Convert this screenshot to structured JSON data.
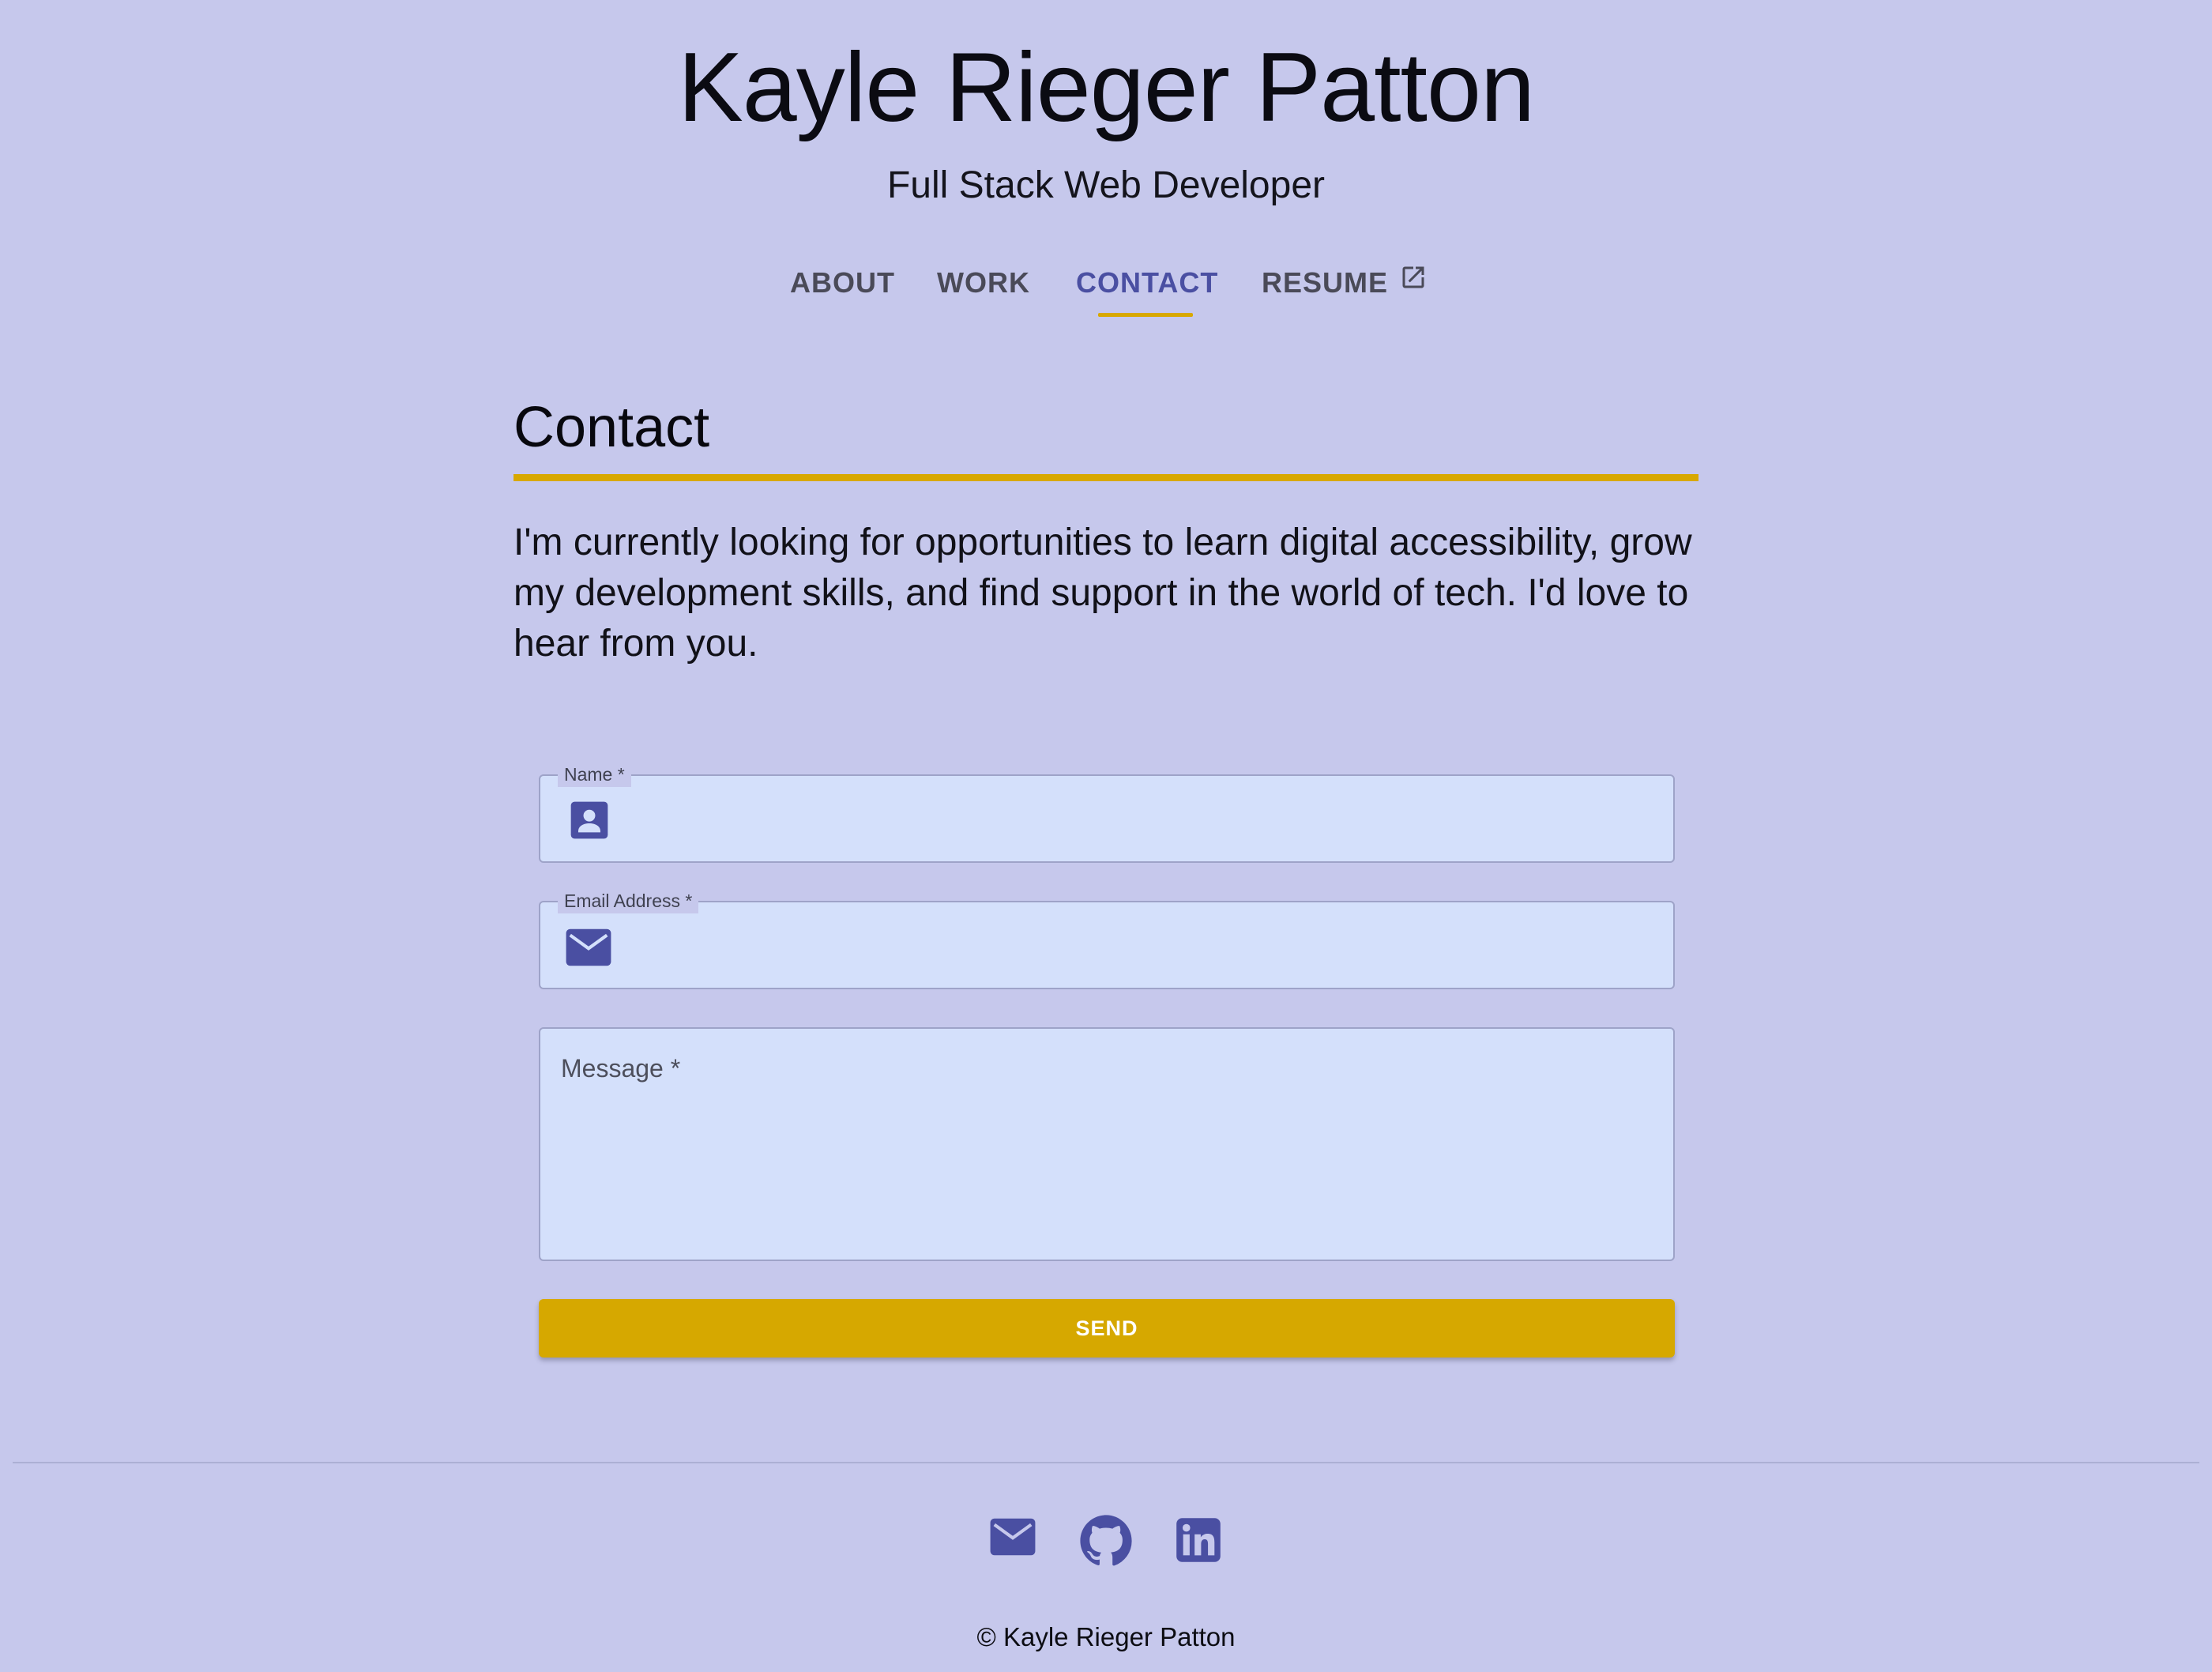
{
  "header": {
    "title": "Kayle Rieger Patton",
    "subtitle": "Full Stack Web Developer"
  },
  "nav": {
    "about": "ABOUT",
    "work": "WORK",
    "contact": "CONTACT",
    "resume": "RESUME",
    "active": "CONTACT"
  },
  "section": {
    "title": "Contact",
    "intro": "I'm currently looking for opportunities to learn digital accessibility, grow my development skills, and find support in the world of tech. I'd love to hear from you."
  },
  "form": {
    "name_label": "Name *",
    "name_value": "",
    "email_label": "Email Address *",
    "email_value": "",
    "message_label": "Message *",
    "message_value": "",
    "send_label": "SEND"
  },
  "footer": {
    "icons": [
      "mail-icon",
      "github-icon",
      "linkedin-icon"
    ],
    "copyright": "© Kayle Rieger Patton"
  },
  "colors": {
    "background": "#c6c8ec",
    "accent": "#d8a800",
    "primary": "#4a4fa2",
    "field_bg": "#d4e0fb"
  }
}
